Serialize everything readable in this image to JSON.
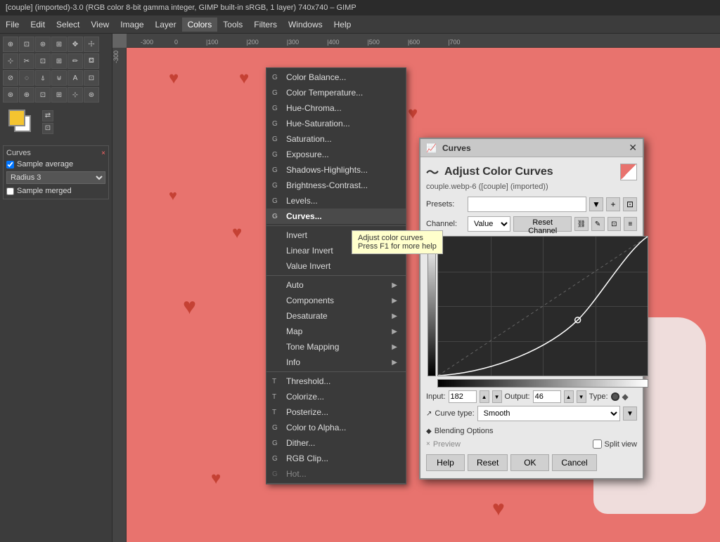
{
  "titlebar": {
    "text": "[couple] (imported)-3.0 (RGB color 8-bit gamma integer, GIMP built-in sRGB, 1 layer) 740x740 – GIMP"
  },
  "menubar": {
    "items": [
      "File",
      "Edit",
      "Select",
      "View",
      "Image",
      "Layer",
      "Colors",
      "Tools",
      "Filters",
      "Windows",
      "Help"
    ]
  },
  "colors_menu": {
    "items": [
      {
        "label": "Color Balance...",
        "icon": "G",
        "has_submenu": false,
        "section": 1
      },
      {
        "label": "Color Temperature...",
        "icon": "G",
        "has_submenu": false,
        "section": 1
      },
      {
        "label": "Hue-Chroma...",
        "icon": "G",
        "has_submenu": false,
        "section": 1
      },
      {
        "label": "Hue-Saturation...",
        "icon": "G",
        "has_submenu": false,
        "section": 1
      },
      {
        "label": "Saturation...",
        "icon": "G",
        "has_submenu": false,
        "section": 1
      },
      {
        "label": "Exposure...",
        "icon": "G",
        "has_submenu": false,
        "section": 1
      },
      {
        "label": "Shadows-Highlights...",
        "icon": "G",
        "has_submenu": false,
        "section": 1
      },
      {
        "label": "Brightness-Contrast...",
        "icon": "G",
        "has_submenu": false,
        "section": 1
      },
      {
        "label": "Levels...",
        "icon": "G",
        "has_submenu": false,
        "section": 1
      },
      {
        "label": "Curves...",
        "icon": "G",
        "has_submenu": false,
        "section": 1,
        "highlighted": true
      },
      {
        "label": "Invert",
        "icon": "",
        "has_submenu": false,
        "section": 2
      },
      {
        "label": "Linear Invert",
        "icon": "",
        "has_submenu": false,
        "section": 2
      },
      {
        "label": "Value Invert",
        "icon": "",
        "has_submenu": false,
        "section": 2
      },
      {
        "label": "Auto",
        "icon": "",
        "has_submenu": true,
        "section": 3
      },
      {
        "label": "Components",
        "icon": "",
        "has_submenu": true,
        "section": 3
      },
      {
        "label": "Desaturate",
        "icon": "",
        "has_submenu": true,
        "section": 3
      },
      {
        "label": "Map",
        "icon": "",
        "has_submenu": true,
        "section": 3
      },
      {
        "label": "Tone Mapping",
        "icon": "",
        "has_submenu": true,
        "section": 3
      },
      {
        "label": "Info",
        "icon": "",
        "has_submenu": true,
        "section": 3
      },
      {
        "label": "Threshold...",
        "icon": "T",
        "has_submenu": false,
        "section": 4
      },
      {
        "label": "Colorize...",
        "icon": "T",
        "has_submenu": false,
        "section": 4
      },
      {
        "label": "Posterize...",
        "icon": "T",
        "has_submenu": false,
        "section": 4
      },
      {
        "label": "Color to Alpha...",
        "icon": "G",
        "has_submenu": false,
        "section": 4
      },
      {
        "label": "Dither...",
        "icon": "G",
        "has_submenu": false,
        "section": 4
      },
      {
        "label": "RGB Clip...",
        "icon": "G",
        "has_submenu": false,
        "section": 4
      },
      {
        "label": "Hot...",
        "icon": "G",
        "has_submenu": false,
        "section": 4,
        "disabled": true
      }
    ]
  },
  "tooltip": {
    "line1": "Adjust color curves",
    "line2": "Press F1 for more help"
  },
  "curves_dialog": {
    "title": "Curves",
    "heading": "Adjust Color Curves",
    "subtitle": "couple.webp-6 ([couple] (imported))",
    "presets_label": "Presets:",
    "channel_label": "Channel:",
    "channel_value": "Value",
    "reset_channel_btn": "Reset Channel",
    "input_label": "Input:",
    "input_value": "182",
    "output_label": "Output:",
    "output_value": "46",
    "type_label": "Type:",
    "curve_type_label": "Curve type:",
    "curve_type_value": "Smooth",
    "blending_label": "Blending Options",
    "preview_label": "Preview",
    "split_view_label": "Split view",
    "help_btn": "Help",
    "reset_btn": "Reset",
    "ok_btn": "OK",
    "cancel_btn": "Cancel"
  },
  "left_panel": {
    "curves_title": "Curves",
    "sample_label": "Sample average",
    "radius_label": "Radius",
    "radius_value": "3",
    "sample_merged": "Sample merged"
  }
}
